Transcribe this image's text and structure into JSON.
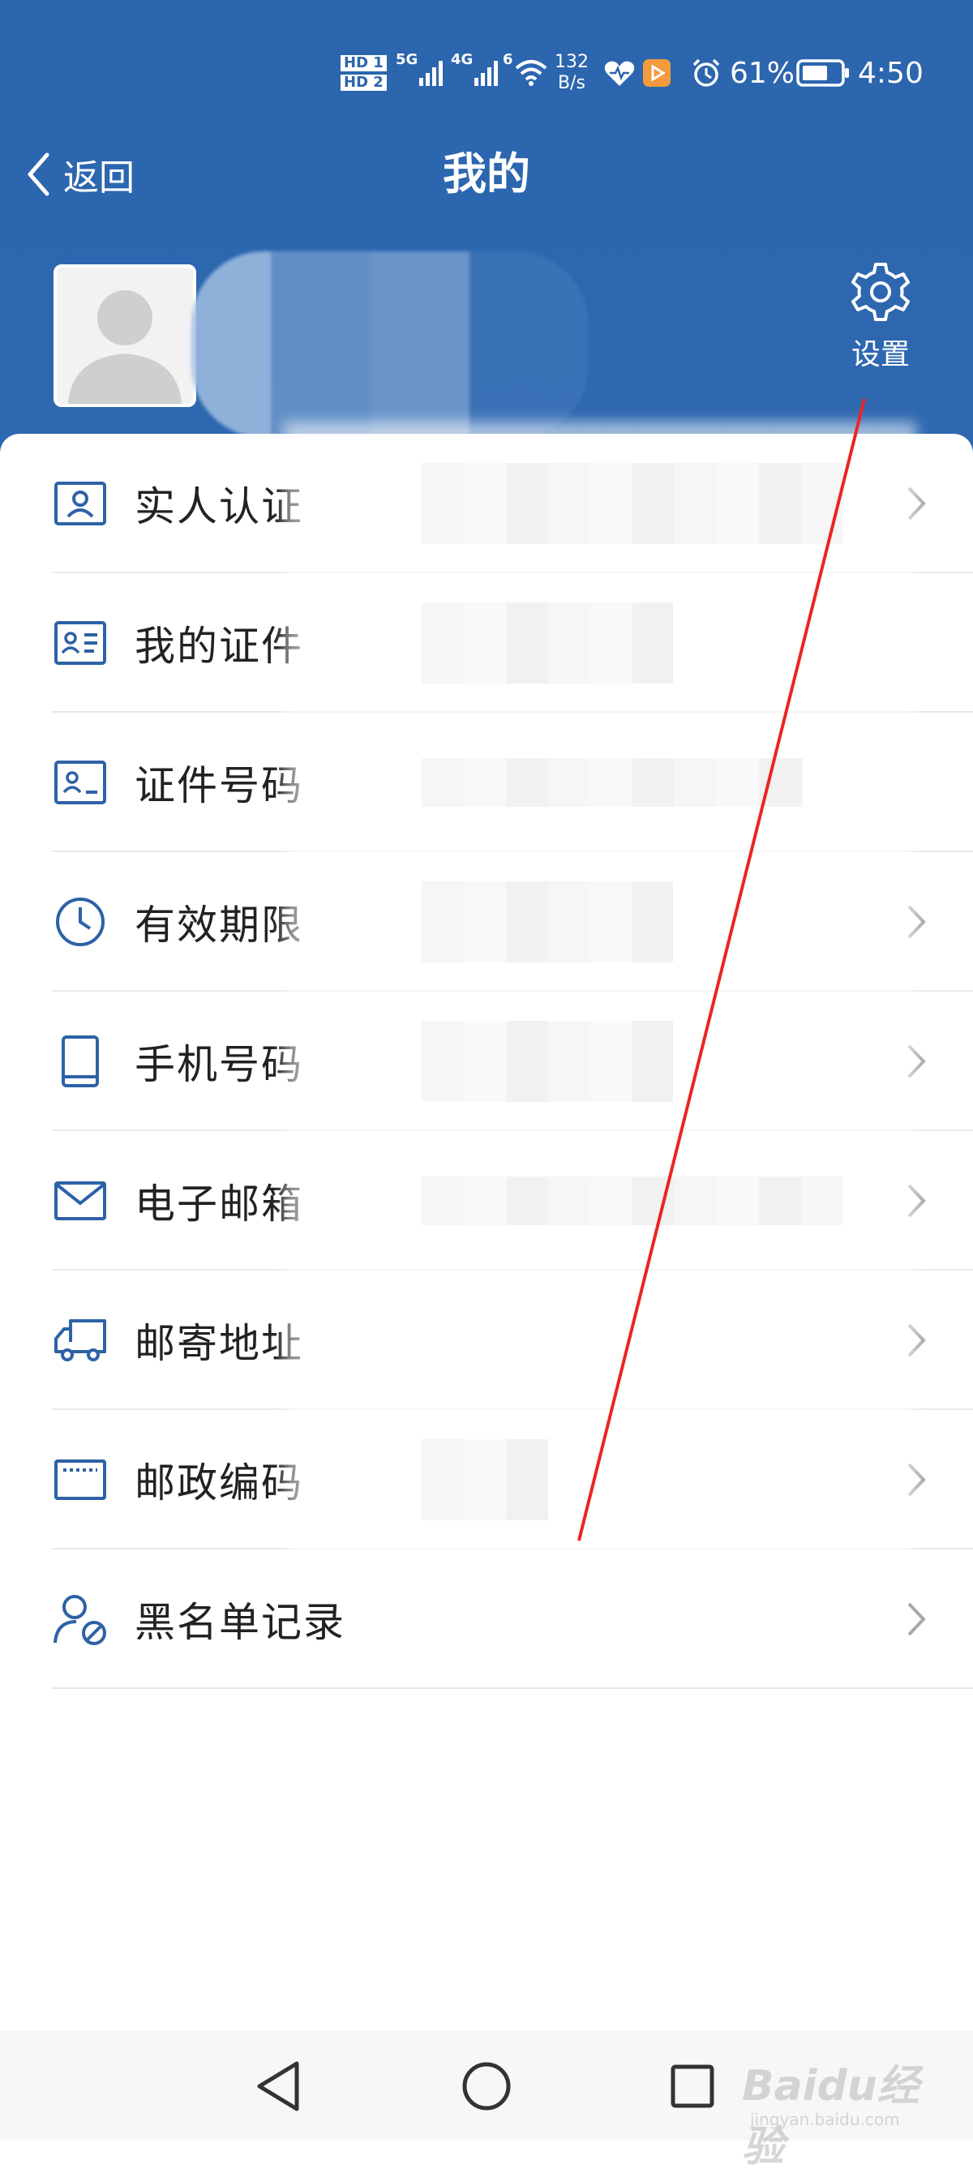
{
  "status_bar": {
    "hd1": "HD 1",
    "hd2": "HD 2",
    "net1": "5G",
    "net2": "4G",
    "wifi_gen": "6",
    "speed_value": "132",
    "speed_unit": "B/s",
    "battery": "61%",
    "time": "4:50"
  },
  "nav": {
    "back_label": "返回",
    "title": "我的"
  },
  "profile": {
    "settings_label": "设置"
  },
  "menu": {
    "items": [
      {
        "label": "实人认证",
        "icon": "id-card-person-icon",
        "chevron": true
      },
      {
        "label": "我的证件",
        "icon": "id-card-lines-icon",
        "chevron": false
      },
      {
        "label": "证件号码",
        "icon": "id-card-number-icon",
        "chevron": false
      },
      {
        "label": "有效期限",
        "icon": "clock-icon",
        "chevron": true
      },
      {
        "label": "手机号码",
        "icon": "phone-icon",
        "chevron": true
      },
      {
        "label": "电子邮箱",
        "icon": "mail-icon",
        "chevron": true
      },
      {
        "label": "邮寄地址",
        "icon": "truck-icon",
        "chevron": true
      },
      {
        "label": "邮政编码",
        "icon": "postcode-icon",
        "chevron": true
      },
      {
        "label": "黑名单记录",
        "icon": "user-blocked-icon",
        "chevron": true
      }
    ]
  },
  "watermark": {
    "main": "Baidu经验",
    "sub": "jingyan.baidu.com"
  },
  "colors": {
    "header_blue": "#2b65ae",
    "icon_blue": "#2d62a6",
    "annotation_red": "#e8262a"
  }
}
